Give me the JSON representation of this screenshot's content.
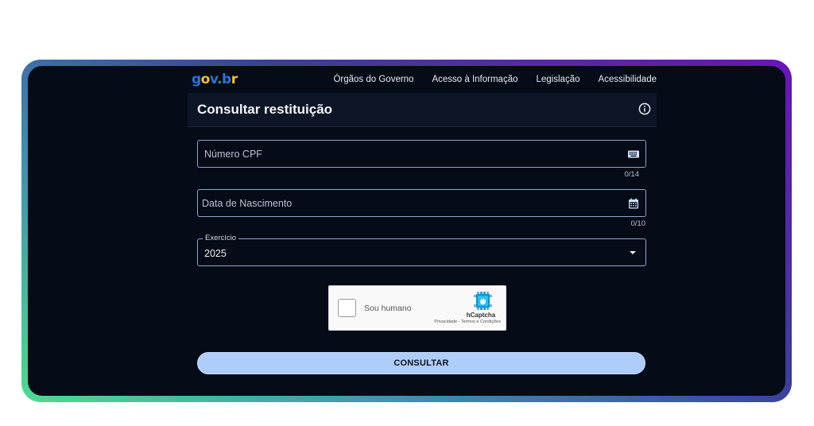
{
  "header": {
    "logo": {
      "g": "g",
      "o": "o",
      "v": "v",
      "dot": ".",
      "b": "b",
      "r": "r"
    },
    "nav": [
      {
        "label": "Órgãos do Governo"
      },
      {
        "label": "Acesso à Informação"
      },
      {
        "label": "Legislação"
      },
      {
        "label": "Acessibilidade"
      }
    ]
  },
  "card": {
    "title": "Consultar restituição",
    "info_icon": "info-circle-icon"
  },
  "form": {
    "cpf": {
      "placeholder": "Número CPF",
      "counter": "0/14",
      "icon": "keyboard-icon"
    },
    "birth": {
      "placeholder": "Data de Nascimento",
      "counter": "0/10",
      "icon": "calendar-icon"
    },
    "exercicio": {
      "label": "Exercício",
      "value": "2025",
      "icon": "chevron-down-icon"
    },
    "captcha": {
      "label": "Sou humano",
      "brand": "hCaptcha",
      "privacy": "Privacidade",
      "separator": " - ",
      "terms": "Termos e Condições"
    },
    "submit_label": "CONSULTAR"
  },
  "colors": {
    "background": "#050b17",
    "card_header": "#0d1626",
    "field_border": "#8fa6c8",
    "button": "#afcdf9",
    "frame_gradient_start": "#4ddc8f",
    "frame_gradient_end": "#6a14b8"
  }
}
